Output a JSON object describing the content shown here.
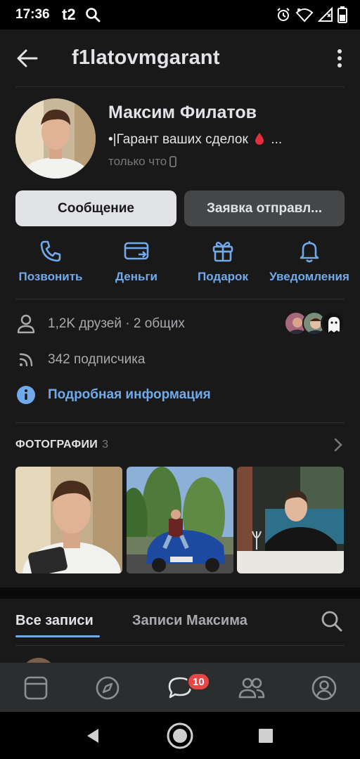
{
  "status_bar": {
    "time": "17:36",
    "carrier": "t2"
  },
  "header": {
    "username": "f1latovmgarant"
  },
  "profile": {
    "name": "Максим Филатов",
    "status_prefix": "•|Гарант ваших сделок",
    "status_suffix": "...",
    "last_seen": "только что"
  },
  "buttons": {
    "message": "Сообщение",
    "request": "Заявка отправл..."
  },
  "actions": [
    {
      "label": "Позвонить",
      "icon": "phone-icon"
    },
    {
      "label": "Деньги",
      "icon": "money-icon"
    },
    {
      "label": "Подарок",
      "icon": "gift-icon"
    },
    {
      "label": "Уведомления",
      "icon": "bell-icon"
    }
  ],
  "info": {
    "friends": "1,2K друзей · 2 общих",
    "followers": "342 подписчика",
    "details": "Подробная информация"
  },
  "photos": {
    "title": "ФОТОГРАФИИ",
    "count": "3"
  },
  "tabs": {
    "all": "Все записи",
    "own": "Записи Максима"
  },
  "nav": {
    "messages_badge": "10"
  },
  "colors": {
    "accent": "#71aaeb",
    "background": "#19191a",
    "badge": "#e64646"
  }
}
